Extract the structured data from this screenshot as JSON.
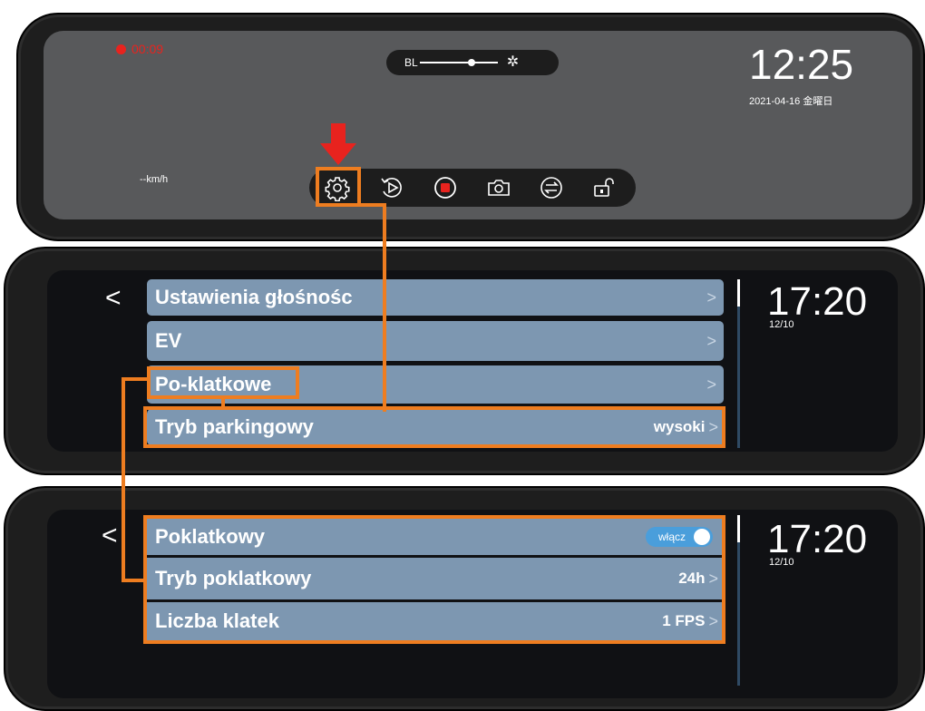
{
  "dashcam_home": {
    "recording_time": "00:09",
    "backlight_label": "BL",
    "backlight_level": 0.67,
    "clock": "12:25",
    "date": "2021-04-16 金曜日",
    "speed": "--km/h",
    "toolbar": [
      {
        "icon": "gear-icon",
        "name": "settings-button"
      },
      {
        "icon": "playback-icon",
        "name": "playback-button"
      },
      {
        "icon": "record-stop-icon",
        "name": "record-button"
      },
      {
        "icon": "camera-icon",
        "name": "snapshot-button"
      },
      {
        "icon": "swap-camera-icon",
        "name": "switch-camera-button"
      },
      {
        "icon": "unlock-icon",
        "name": "lock-button"
      }
    ]
  },
  "settings_menu": {
    "back": "<",
    "clock": "17:20",
    "date": "12/10",
    "items": [
      {
        "label": "Ustawienia głośnośc",
        "value": ""
      },
      {
        "label": "EV",
        "value": ""
      },
      {
        "label": "Po-klatkowe",
        "value": ""
      },
      {
        "label": "Tryb parkingowy",
        "value": "wysoki"
      }
    ]
  },
  "timelapse_menu": {
    "back": "<",
    "clock": "17:20",
    "date": "12/10",
    "items": [
      {
        "label": "Poklatkowy",
        "toggle": "włącz"
      },
      {
        "label": "Tryb poklatkowy",
        "value": "24h"
      },
      {
        "label": "Liczba klatek",
        "value": "1 FPS"
      }
    ]
  },
  "colors": {
    "highlight": "#ee7d20",
    "menu_row": "#7d97b1",
    "record": "#e8231e",
    "toggle_on": "#4a9edb"
  }
}
